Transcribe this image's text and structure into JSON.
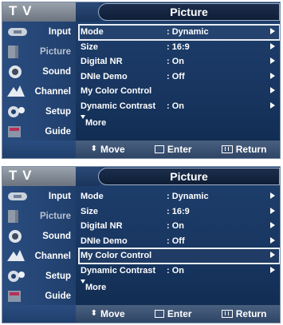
{
  "screens": [
    {
      "header": {
        "tv_label": "T V",
        "title": "Picture"
      },
      "sidebar": [
        {
          "label": "Input",
          "icon": "input-icon"
        },
        {
          "label": "Picture",
          "icon": "picture-icon",
          "active": true
        },
        {
          "label": "Sound",
          "icon": "sound-icon"
        },
        {
          "label": "Channel",
          "icon": "channel-icon"
        },
        {
          "label": "Setup",
          "icon": "setup-icon"
        },
        {
          "label": "Guide",
          "icon": "guide-icon"
        }
      ],
      "menu": [
        {
          "name": "Mode",
          "value": ": Dynamic"
        },
        {
          "name": "Size",
          "value": ": 16:9"
        },
        {
          "name": "Digital NR",
          "value": ": On"
        },
        {
          "name": "DNIe Demo",
          "value": ": Off"
        },
        {
          "name": "My Color Control",
          "value": ""
        },
        {
          "name": "Dynamic Contrast",
          "value": ": On"
        }
      ],
      "selected_index": 0,
      "more_label": "More",
      "footer": {
        "move": "Move",
        "enter": "Enter",
        "return": "Return"
      }
    },
    {
      "header": {
        "tv_label": "T V",
        "title": "Picture"
      },
      "sidebar": [
        {
          "label": "Input",
          "icon": "input-icon"
        },
        {
          "label": "Picture",
          "icon": "picture-icon",
          "active": true
        },
        {
          "label": "Sound",
          "icon": "sound-icon"
        },
        {
          "label": "Channel",
          "icon": "channel-icon"
        },
        {
          "label": "Setup",
          "icon": "setup-icon"
        },
        {
          "label": "Guide",
          "icon": "guide-icon"
        }
      ],
      "menu": [
        {
          "name": "Mode",
          "value": ": Dynamic"
        },
        {
          "name": "Size",
          "value": ": 16:9"
        },
        {
          "name": "Digital NR",
          "value": ": On"
        },
        {
          "name": "DNIe Demo",
          "value": ": Off"
        },
        {
          "name": "My Color Control",
          "value": ""
        },
        {
          "name": "Dynamic Contrast",
          "value": ": On"
        }
      ],
      "selected_index": 4,
      "more_label": "More",
      "footer": {
        "move": "Move",
        "enter": "Enter",
        "return": "Return"
      }
    }
  ],
  "colors": {
    "osd_bg": "#17355f",
    "highlight": "#e9edf3",
    "text": "#ffffff"
  }
}
